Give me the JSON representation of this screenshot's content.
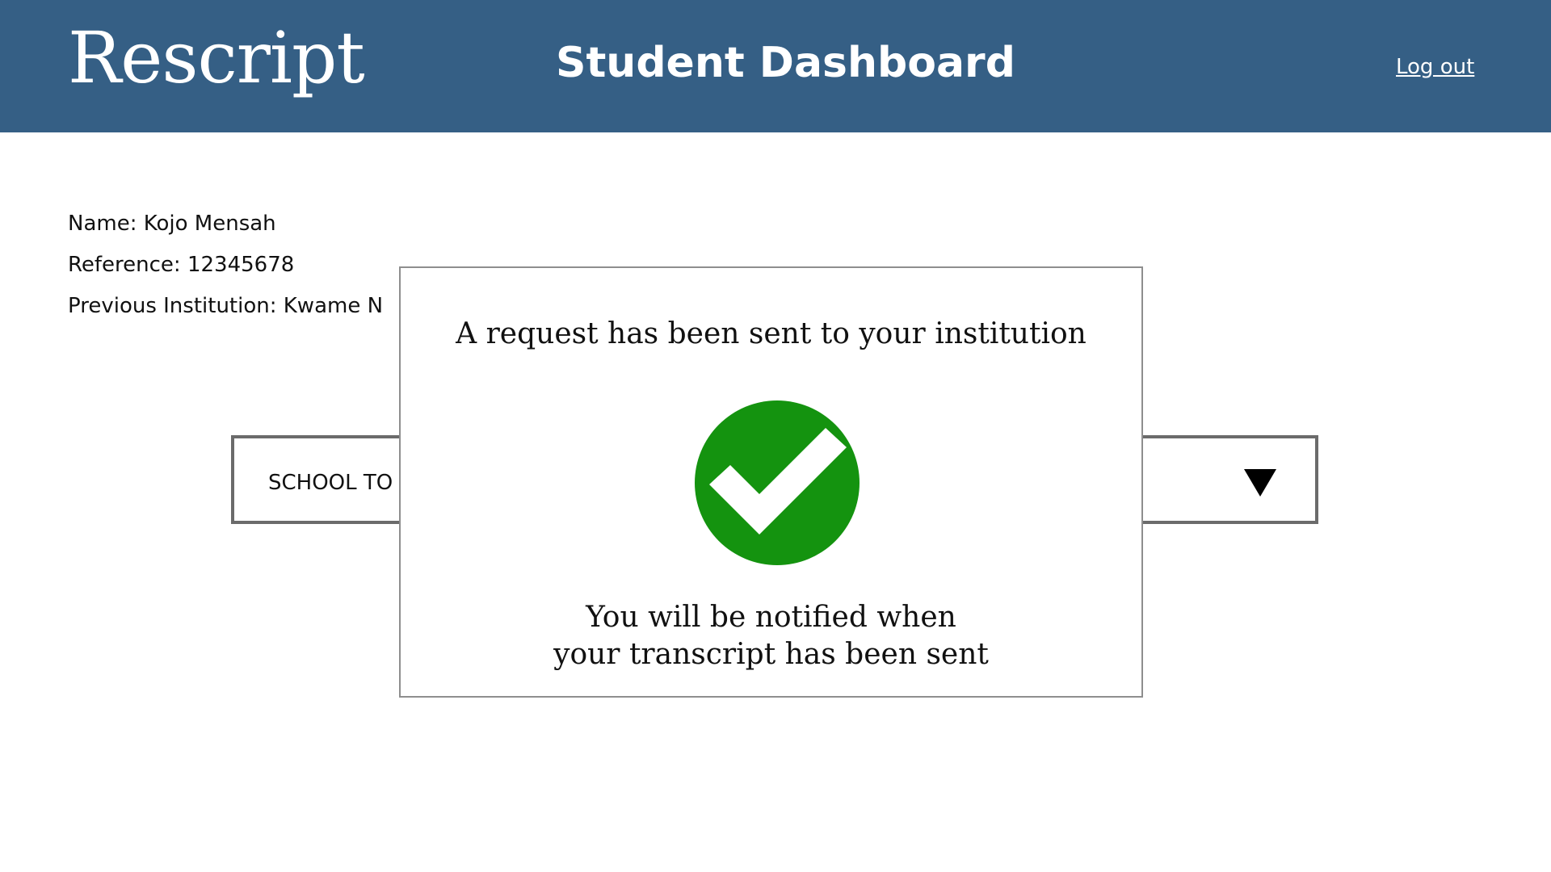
{
  "header": {
    "logo": "Rescript",
    "title": "Student Dashboard",
    "logout_label": "Log out",
    "background_color": "#355f85"
  },
  "student": {
    "name_line": "Name: Kojo Mensah",
    "reference_line": "Reference: 12345678",
    "institution_line": "Previous Institution: Kwame N"
  },
  "school_select": {
    "label": "SCHOOL TO",
    "arrow_icon": "triangle-down-icon"
  },
  "modal": {
    "heading": "A request has been sent to your institution",
    "icon": "check-circle-icon",
    "icon_color": "#14930f",
    "message_line_1": "You will be notified when",
    "message_line_2": "your transcript has been sent"
  }
}
